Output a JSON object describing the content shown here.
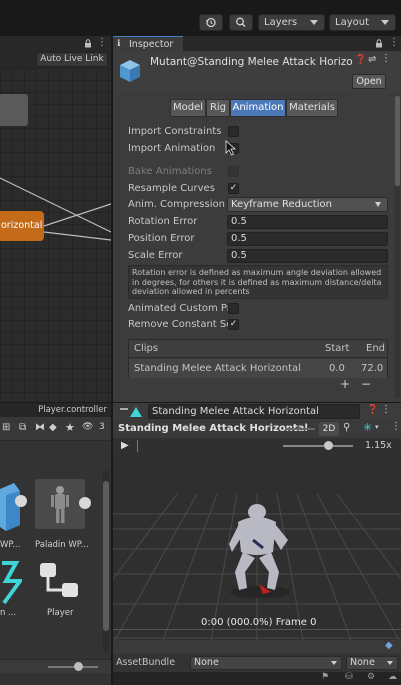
{
  "toolbar": {
    "history_icon": "history-icon",
    "search_icon": "search-icon",
    "layers_label": "Layers",
    "layout_label": "Layout"
  },
  "animator": {
    "auto_live_link_label": "Auto Live Link",
    "state_node_label": "orizontal"
  },
  "inspector": {
    "tab_label": "Inspector",
    "asset_title": "Mutant@Standing Melee Attack Horizontal",
    "open_label": "Open",
    "tabs": [
      "Model",
      "Rig",
      "Animation",
      "Materials"
    ],
    "active_tab": "Animation",
    "import_constraints_label": "Import Constraints",
    "import_animation_label": "Import Animation",
    "bake_animations_label": "Bake Animations",
    "resample_curves_label": "Resample Curves",
    "resample_check": "✓",
    "anim_compression_label": "Anim. Compression",
    "anim_compression_value": "Keyframe Reduction",
    "rotation_error_label": "Rotation Error",
    "rotation_error_value": "0.5",
    "position_error_label": "Position Error",
    "position_error_value": "0.5",
    "scale_error_label": "Scale Error",
    "scale_error_value": "0.5",
    "help_text": "Rotation error is defined as maximum angle deviation allowed in degrees, for others it is defined as maximum distance/delta deviation allowed in percents",
    "animated_custom_label": "Animated Custom Prc",
    "remove_constant_label": "Remove Constant Sc",
    "remove_constant_check": "✓",
    "clips": {
      "header": "Clips",
      "start_header": "Start",
      "end_header": "End",
      "rows": [
        {
          "name": "Standing Melee Attack Horizontal",
          "start": "0.0",
          "end": "72.0"
        }
      ],
      "add_label": "+",
      "remove_label": "−"
    }
  },
  "project": {
    "path": "Player.controller",
    "filter_count": "3",
    "assets": [
      {
        "label": "WP..."
      },
      {
        "label": "Paladin WP..."
      },
      {
        "label": "n ..."
      },
      {
        "label": "Player"
      }
    ]
  },
  "preview": {
    "clip_field_value": "Standing Melee Attack Horizontal",
    "title": "Standing Melee Attack Horizontal",
    "mode_2d": "2D",
    "speed_label": "1.15x",
    "frame_readout": "0:00 (000.0%) Frame 0",
    "assetbundle_label": "AssetBundle",
    "assetbundle_value": "None",
    "variant_value": "None"
  }
}
